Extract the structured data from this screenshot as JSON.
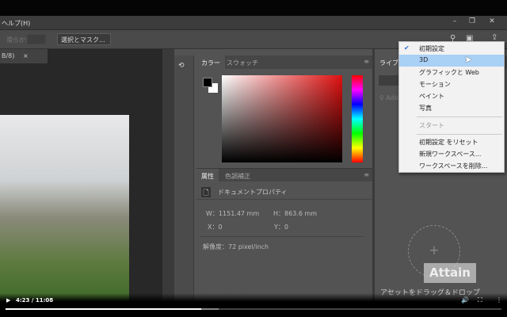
{
  "menubar": {
    "help": "ヘルプ(H)",
    "window_controls": {
      "minimize": "–",
      "restore": "❐",
      "close": "✕"
    }
  },
  "options": {
    "feather_label": "滑らか：",
    "select_mask_button": "選択とマスク..."
  },
  "document": {
    "tab_label": "B/8)",
    "tab_close": "×"
  },
  "color_panel": {
    "tabs": [
      "カラー",
      "スウォッチ"
    ],
    "foreground": "#000000",
    "background": "#ffffff",
    "hue": "#e01010"
  },
  "properties_panel": {
    "tabs": [
      "属性",
      "色調補正"
    ],
    "section_title": "ドキュメントプロパティ",
    "w_label": "W：",
    "w_value": "1151.47 mm",
    "h_label": "H：",
    "h_value": "863.6 mm",
    "x_label": "X：",
    "x_value": "0",
    "y_label": "Y：",
    "y_value": "0",
    "resolution": "解像度：72 pixel/inch"
  },
  "libraries_panel": {
    "tab": "ライブラ",
    "search_placeholder": "Adob",
    "drop_text": "アセットをドラッグ＆ドロップ",
    "watermark": "Attain"
  },
  "workspace_menu": {
    "items": [
      {
        "label": "初期設定",
        "checked": true
      },
      {
        "label": "3D",
        "highlighted": true
      },
      {
        "label": "グラフィックと Web"
      },
      {
        "label": "モーション"
      },
      {
        "label": "ペイント"
      },
      {
        "label": "写真"
      }
    ],
    "disabled_item": "スタート",
    "actions": [
      "初期設定 をリセット",
      "新規ワークスペース...",
      "ワークスペースを削除..."
    ]
  },
  "video": {
    "time": "4:23 / 11:08",
    "progress": 0.394,
    "buffered": 0.43
  }
}
